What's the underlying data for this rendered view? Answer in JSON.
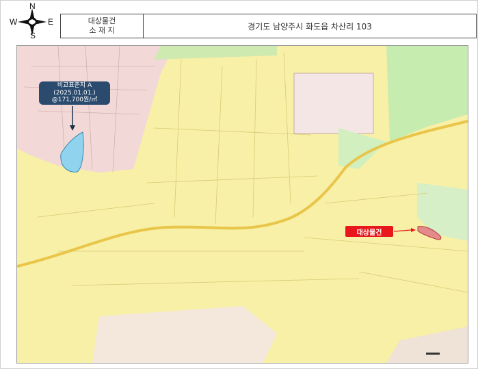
{
  "compass": {
    "north": "N",
    "south": "S",
    "east": "E",
    "west": "W"
  },
  "header": {
    "label_line1": "대상물건",
    "label_line2": "소 재 지",
    "address": "경기도 남양주시 화도읍 차산리 103"
  },
  "map": {
    "comparison_callout": {
      "line1": "비교표준지 A",
      "line2": "(2025.01.01.)",
      "line3": "@171,700원/㎡"
    },
    "target_label": "대상물건",
    "colors": {
      "background_yellow": "#f7f0a6",
      "green_zone": "#c6ecb0",
      "urban_pink": "#f2d8d6",
      "road": "#e9c54a",
      "comparison_parcel": "#8fd3ef",
      "target_parcel": "#e58a8a",
      "callout_bg": "#2a4a6e",
      "target_label_bg": "#e8171b"
    }
  }
}
